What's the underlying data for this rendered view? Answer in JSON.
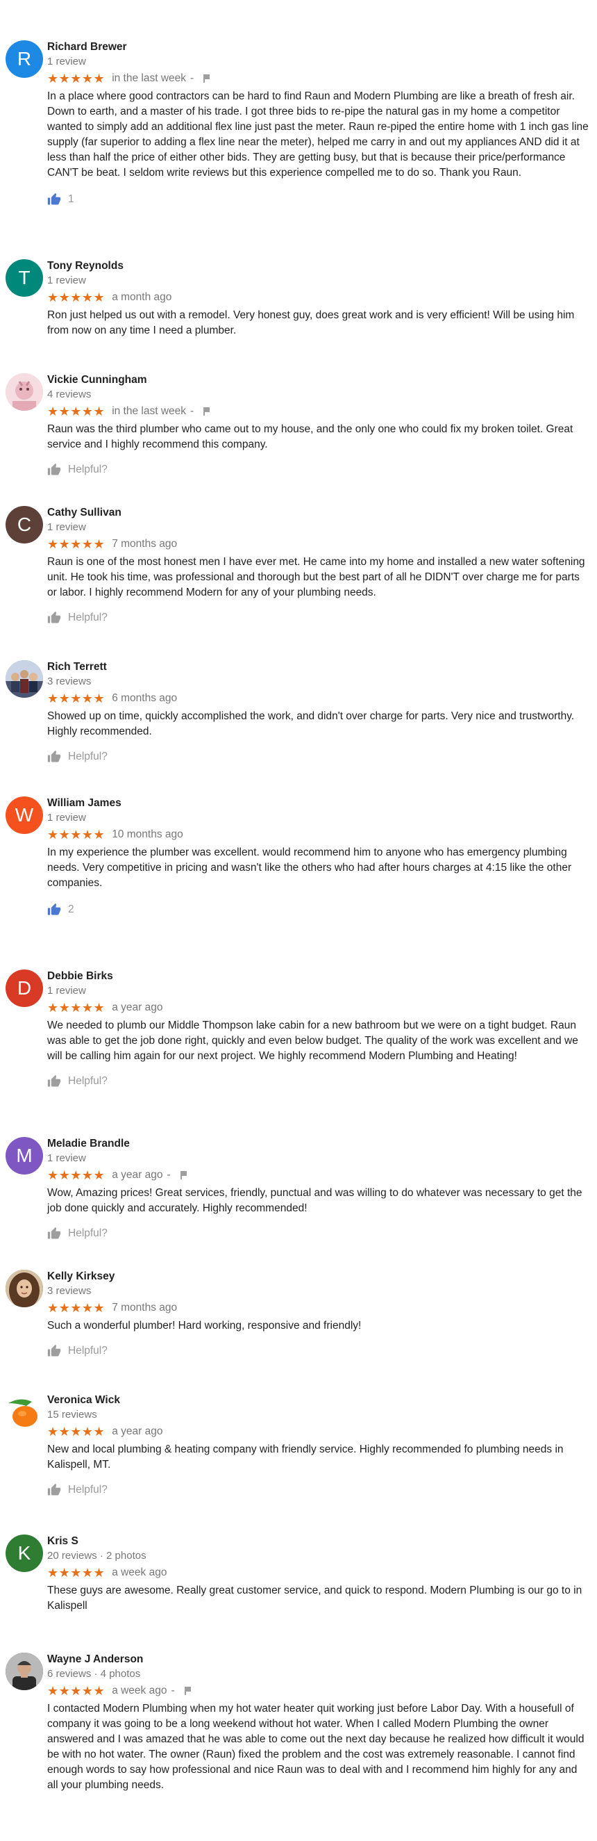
{
  "reviews": [
    {
      "name": "Richard Brewer",
      "meta": "1 review",
      "avatar": {
        "letter": "R",
        "color": "#1e88e5",
        "type": "letter"
      },
      "stars": "★★★★★",
      "time": "in the last week",
      "sep": "-",
      "flag": true,
      "text": "In a place where good contractors can be hard to find Raun and Modern Plumbing are like a breath of fresh air. Down to earth, and a master of his trade. I got three bids to re-pipe the natural gas in my home a competitor wanted to simply add an additional flex line just past the meter. Raun re-piped the entire home with 1 inch gas line supply (far superior to adding a flex line near the meter), helped me carry in and out my appliances AND did it at less than half the price of either other bids. They are getting busy, but that is because their price/performance CAN'T be beat. I seldom write reviews but this experience compelled me to do so. Thank you Raun.",
      "action": {
        "type": "liked",
        "label": "1"
      }
    },
    {
      "name": "Tony Reynolds",
      "meta": "1 review",
      "avatar": {
        "letter": "T",
        "color": "#00897b",
        "type": "letter"
      },
      "stars": "★★★★★",
      "time": "a month ago",
      "text": "Ron just helped us out with a remodel.  Very honest guy, does great work and is very efficient! Will be using him from now on any time I need a plumber.",
      "action": null
    },
    {
      "name": "Vickie Cunningham",
      "meta": "4 reviews",
      "avatar": {
        "type": "photo-pink",
        "color": "#f3d4da"
      },
      "stars": "★★★★★",
      "time": "in the last week",
      "sep": "-",
      "flag": true,
      "text": "Raun was the third plumber who came out to my house, and the only one who could fix my broken toilet. Great service and I highly recommend this company.",
      "action": {
        "type": "helpful",
        "label": "Helpful?"
      }
    },
    {
      "name": "Cathy Sullivan",
      "meta": "1 review",
      "avatar": {
        "letter": "C",
        "color": "#5d4037",
        "type": "letter"
      },
      "stars": "★★★★★",
      "time": "7 months ago",
      "text": "Raun is one of the most honest men I have ever met. He came into my home and installed a new water softening unit.  He took his time, was professional and thorough but the best part of all he DIDN'T over charge me for parts or labor.  I highly recommend Modern for any of your plumbing needs.",
      "action": {
        "type": "helpful",
        "label": "Helpful?"
      }
    },
    {
      "name": "Rich Terrett",
      "meta": "3 reviews",
      "avatar": {
        "type": "photo-group",
        "color": "#8a93a8"
      },
      "stars": "★★★★★",
      "time": "6 months ago",
      "text": "Showed up on time, quickly accomplished the work, and didn't over charge for parts.  Very nice and trustworthy.  Highly recommended.",
      "action": {
        "type": "helpful",
        "label": "Helpful?"
      }
    },
    {
      "name": "William James",
      "meta": "1 review",
      "avatar": {
        "letter": "W",
        "color": "#f4511e",
        "type": "letter"
      },
      "stars": "★★★★★",
      "time": "10 months ago",
      "text": "In my experience the plumber was excellent. would recommend him to anyone who has emergency plumbing needs. Very competitive in pricing and wasn't like the others who had after hours charges at 4:15 like the other companies.",
      "action": {
        "type": "liked",
        "label": "2"
      }
    },
    {
      "name": "Debbie Birks",
      "meta": "1 review",
      "avatar": {
        "letter": "D",
        "color": "#d93a25",
        "type": "letter"
      },
      "stars": "★★★★★",
      "time": "a year ago",
      "text": "We needed to plumb our Middle Thompson lake cabin for a new bathroom but we were on a tight budget.  Raun was able to get the job done right, quickly and even below budget.  The quality of the work was excellent and we will be calling him again for our next project.  We highly recommend Modern Plumbing and Heating!",
      "action": {
        "type": "helpful",
        "label": "Helpful?"
      }
    },
    {
      "name": "Meladie Brandle",
      "meta": "1 review",
      "avatar": {
        "letter": "M",
        "color": "#7e57c2",
        "type": "letter"
      },
      "stars": "★★★★★",
      "time": "a year ago",
      "sep": "-",
      "flag": true,
      "text": "Wow, Amazing prices! Great services, friendly, punctual and was willing to do whatever was necessary to get the job done quickly and accurately. Highly recommended!",
      "action": {
        "type": "helpful",
        "label": "Helpful?"
      }
    },
    {
      "name": "Kelly Kirksey",
      "meta": "3 reviews",
      "avatar": {
        "type": "photo-hair",
        "color": "#6b4a2e"
      },
      "stars": "★★★★★",
      "time": "7 months ago",
      "text": "Such a wonderful plumber! Hard working, responsive and friendly!",
      "action": {
        "type": "helpful",
        "label": "Helpful?"
      }
    },
    {
      "name": "Veronica Wick",
      "meta": "15 reviews",
      "avatar": {
        "type": "photo-orange",
        "color": "#ffffff"
      },
      "stars": "★★★★★",
      "time": "a year ago",
      "text": "New and local plumbing & heating company with friendly service. Highly recommended fo plumbing needs in Kalispell, MT.",
      "action": {
        "type": "helpful",
        "label": "Helpful?"
      }
    },
    {
      "name": "Kris S",
      "meta": "20 reviews · 2 photos",
      "avatar": {
        "letter": "K",
        "color": "#2e7d32",
        "type": "letter"
      },
      "stars": "★★★★★",
      "time": "a week ago",
      "text": "These guys are awesome. Really great customer service, and quick to respond. Modern Plumbing is our go to in Kalispell",
      "action": null
    },
    {
      "name": "Wayne J Anderson",
      "meta": "6 reviews · 4 photos",
      "avatar": {
        "type": "photo-man",
        "color": "#3a3a3a"
      },
      "stars": "★★★★★",
      "time": "a week ago",
      "sep": "-",
      "flag": true,
      "text": "I contacted Modern Plumbing when my hot water heater quit working just before Labor Day. With a housefull of company it was going to be a long weekend without hot water. When I called Modern Plumbing the owner answered and I was amazed that he was able to come out the next day because he realized how difficult it would be with no hot water. The owner (Raun) fixed the problem and the cost was extremely reasonable. I cannot find enough words to say how professional and nice Raun was to deal with and I recommend him highly for any and all your plumbing needs.",
      "action": null
    }
  ]
}
